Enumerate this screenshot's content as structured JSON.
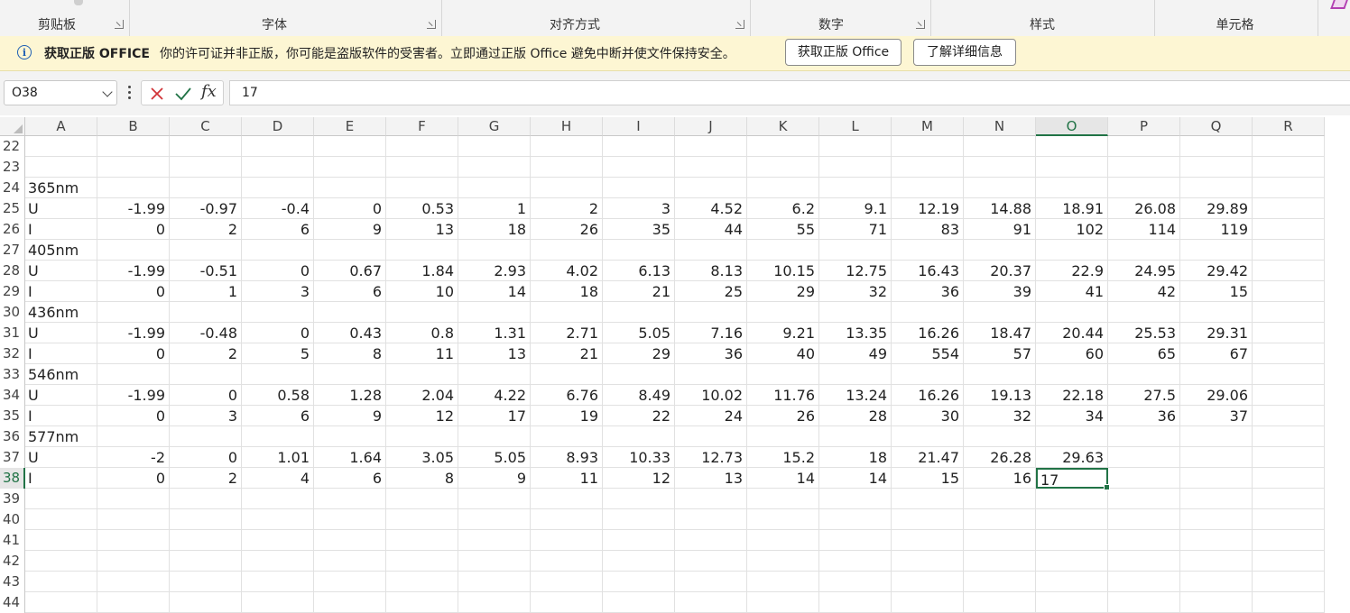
{
  "ribbon": {
    "groups": [
      {
        "label": "剪贴板",
        "launcher": true
      },
      {
        "label": "字体",
        "launcher": true
      },
      {
        "label": "对齐方式",
        "launcher": true
      },
      {
        "label": "数字",
        "launcher": true
      },
      {
        "label": "样式",
        "launcher": false
      },
      {
        "label": "单元格",
        "launcher": false
      }
    ]
  },
  "message_bar": {
    "title": "获取正版 OFFICE",
    "text": "你的许可证并非正版，你可能是盗版软件的受害者。立即通过正版 Office 避免中断并使文件保持安全。",
    "button_get": "获取正版 Office",
    "button_learn": "了解详细信息"
  },
  "formula_bar": {
    "name_box": "O38",
    "fx": "fx",
    "formula": "17"
  },
  "columns": [
    "A",
    "B",
    "C",
    "D",
    "E",
    "F",
    "G",
    "H",
    "I",
    "J",
    "K",
    "L",
    "M",
    "N",
    "O",
    "P",
    "Q",
    "R"
  ],
  "active_column": "O",
  "active_row": 38,
  "rows": [
    {
      "n": 22,
      "cells": []
    },
    {
      "n": 23,
      "cells": []
    },
    {
      "n": 24,
      "cells": [
        "365nm"
      ]
    },
    {
      "n": 25,
      "cells": [
        "U",
        "-1.99",
        "-0.97",
        "-0.4",
        "0",
        "0.53",
        "1",
        "2",
        "3",
        "4.52",
        "6.2",
        "9.1",
        "12.19",
        "14.88",
        "18.91",
        "26.08",
        "29.89"
      ]
    },
    {
      "n": 26,
      "cells": [
        "I",
        "0",
        "2",
        "6",
        "9",
        "13",
        "18",
        "26",
        "35",
        "44",
        "55",
        "71",
        "83",
        "91",
        "102",
        "114",
        "119"
      ]
    },
    {
      "n": 27,
      "cells": [
        "405nm"
      ]
    },
    {
      "n": 28,
      "cells": [
        "U",
        "-1.99",
        "-0.51",
        "0",
        "0.67",
        "1.84",
        "2.93",
        "4.02",
        "6.13",
        "8.13",
        "10.15",
        "12.75",
        "16.43",
        "20.37",
        "22.9",
        "24.95",
        "29.42"
      ]
    },
    {
      "n": 29,
      "cells": [
        "I",
        "0",
        "1",
        "3",
        "6",
        "10",
        "14",
        "18",
        "21",
        "25",
        "29",
        "32",
        "36",
        "39",
        "41",
        "42",
        "15"
      ]
    },
    {
      "n": 30,
      "cells": [
        "436nm"
      ]
    },
    {
      "n": 31,
      "cells": [
        "U",
        "-1.99",
        "-0.48",
        "0",
        "0.43",
        "0.8",
        "1.31",
        "2.71",
        "5.05",
        "7.16",
        "9.21",
        "13.35",
        "16.26",
        "18.47",
        "20.44",
        "25.53",
        "29.31"
      ]
    },
    {
      "n": 32,
      "cells": [
        "I",
        "0",
        "2",
        "5",
        "8",
        "11",
        "13",
        "21",
        "29",
        "36",
        "40",
        "49",
        "554",
        "57",
        "60",
        "65",
        "67"
      ]
    },
    {
      "n": 33,
      "cells": [
        "546nm"
      ]
    },
    {
      "n": 34,
      "cells": [
        "U",
        "-1.99",
        "0",
        "0.58",
        "1.28",
        "2.04",
        "4.22",
        "6.76",
        "8.49",
        "10.02",
        "11.76",
        "13.24",
        "16.26",
        "19.13",
        "22.18",
        "27.5",
        "29.06"
      ]
    },
    {
      "n": 35,
      "cells": [
        "I",
        "0",
        "3",
        "6",
        "9",
        "12",
        "17",
        "19",
        "22",
        "24",
        "26",
        "28",
        "30",
        "32",
        "34",
        "36",
        "37"
      ]
    },
    {
      "n": 36,
      "cells": [
        "577nm"
      ]
    },
    {
      "n": 37,
      "cells": [
        "U",
        "-2",
        "0",
        "1.01",
        "1.64",
        "3.05",
        "5.05",
        "8.93",
        "10.33",
        "12.73",
        "15.2",
        "18",
        "21.47",
        "26.28",
        "29.63"
      ]
    },
    {
      "n": 38,
      "cells": [
        "I",
        "0",
        "2",
        "4",
        "6",
        "8",
        "9",
        "11",
        "12",
        "13",
        "14",
        "14",
        "15",
        "16",
        "17"
      ]
    },
    {
      "n": 39,
      "cells": []
    },
    {
      "n": 40,
      "cells": []
    },
    {
      "n": 41,
      "cells": []
    },
    {
      "n": 42,
      "cells": []
    },
    {
      "n": 43,
      "cells": []
    },
    {
      "n": 44,
      "cells": []
    }
  ],
  "colors": {
    "accent": "#217346",
    "message_bg": "#fdf6d3",
    "info": "#1f5fb3"
  }
}
